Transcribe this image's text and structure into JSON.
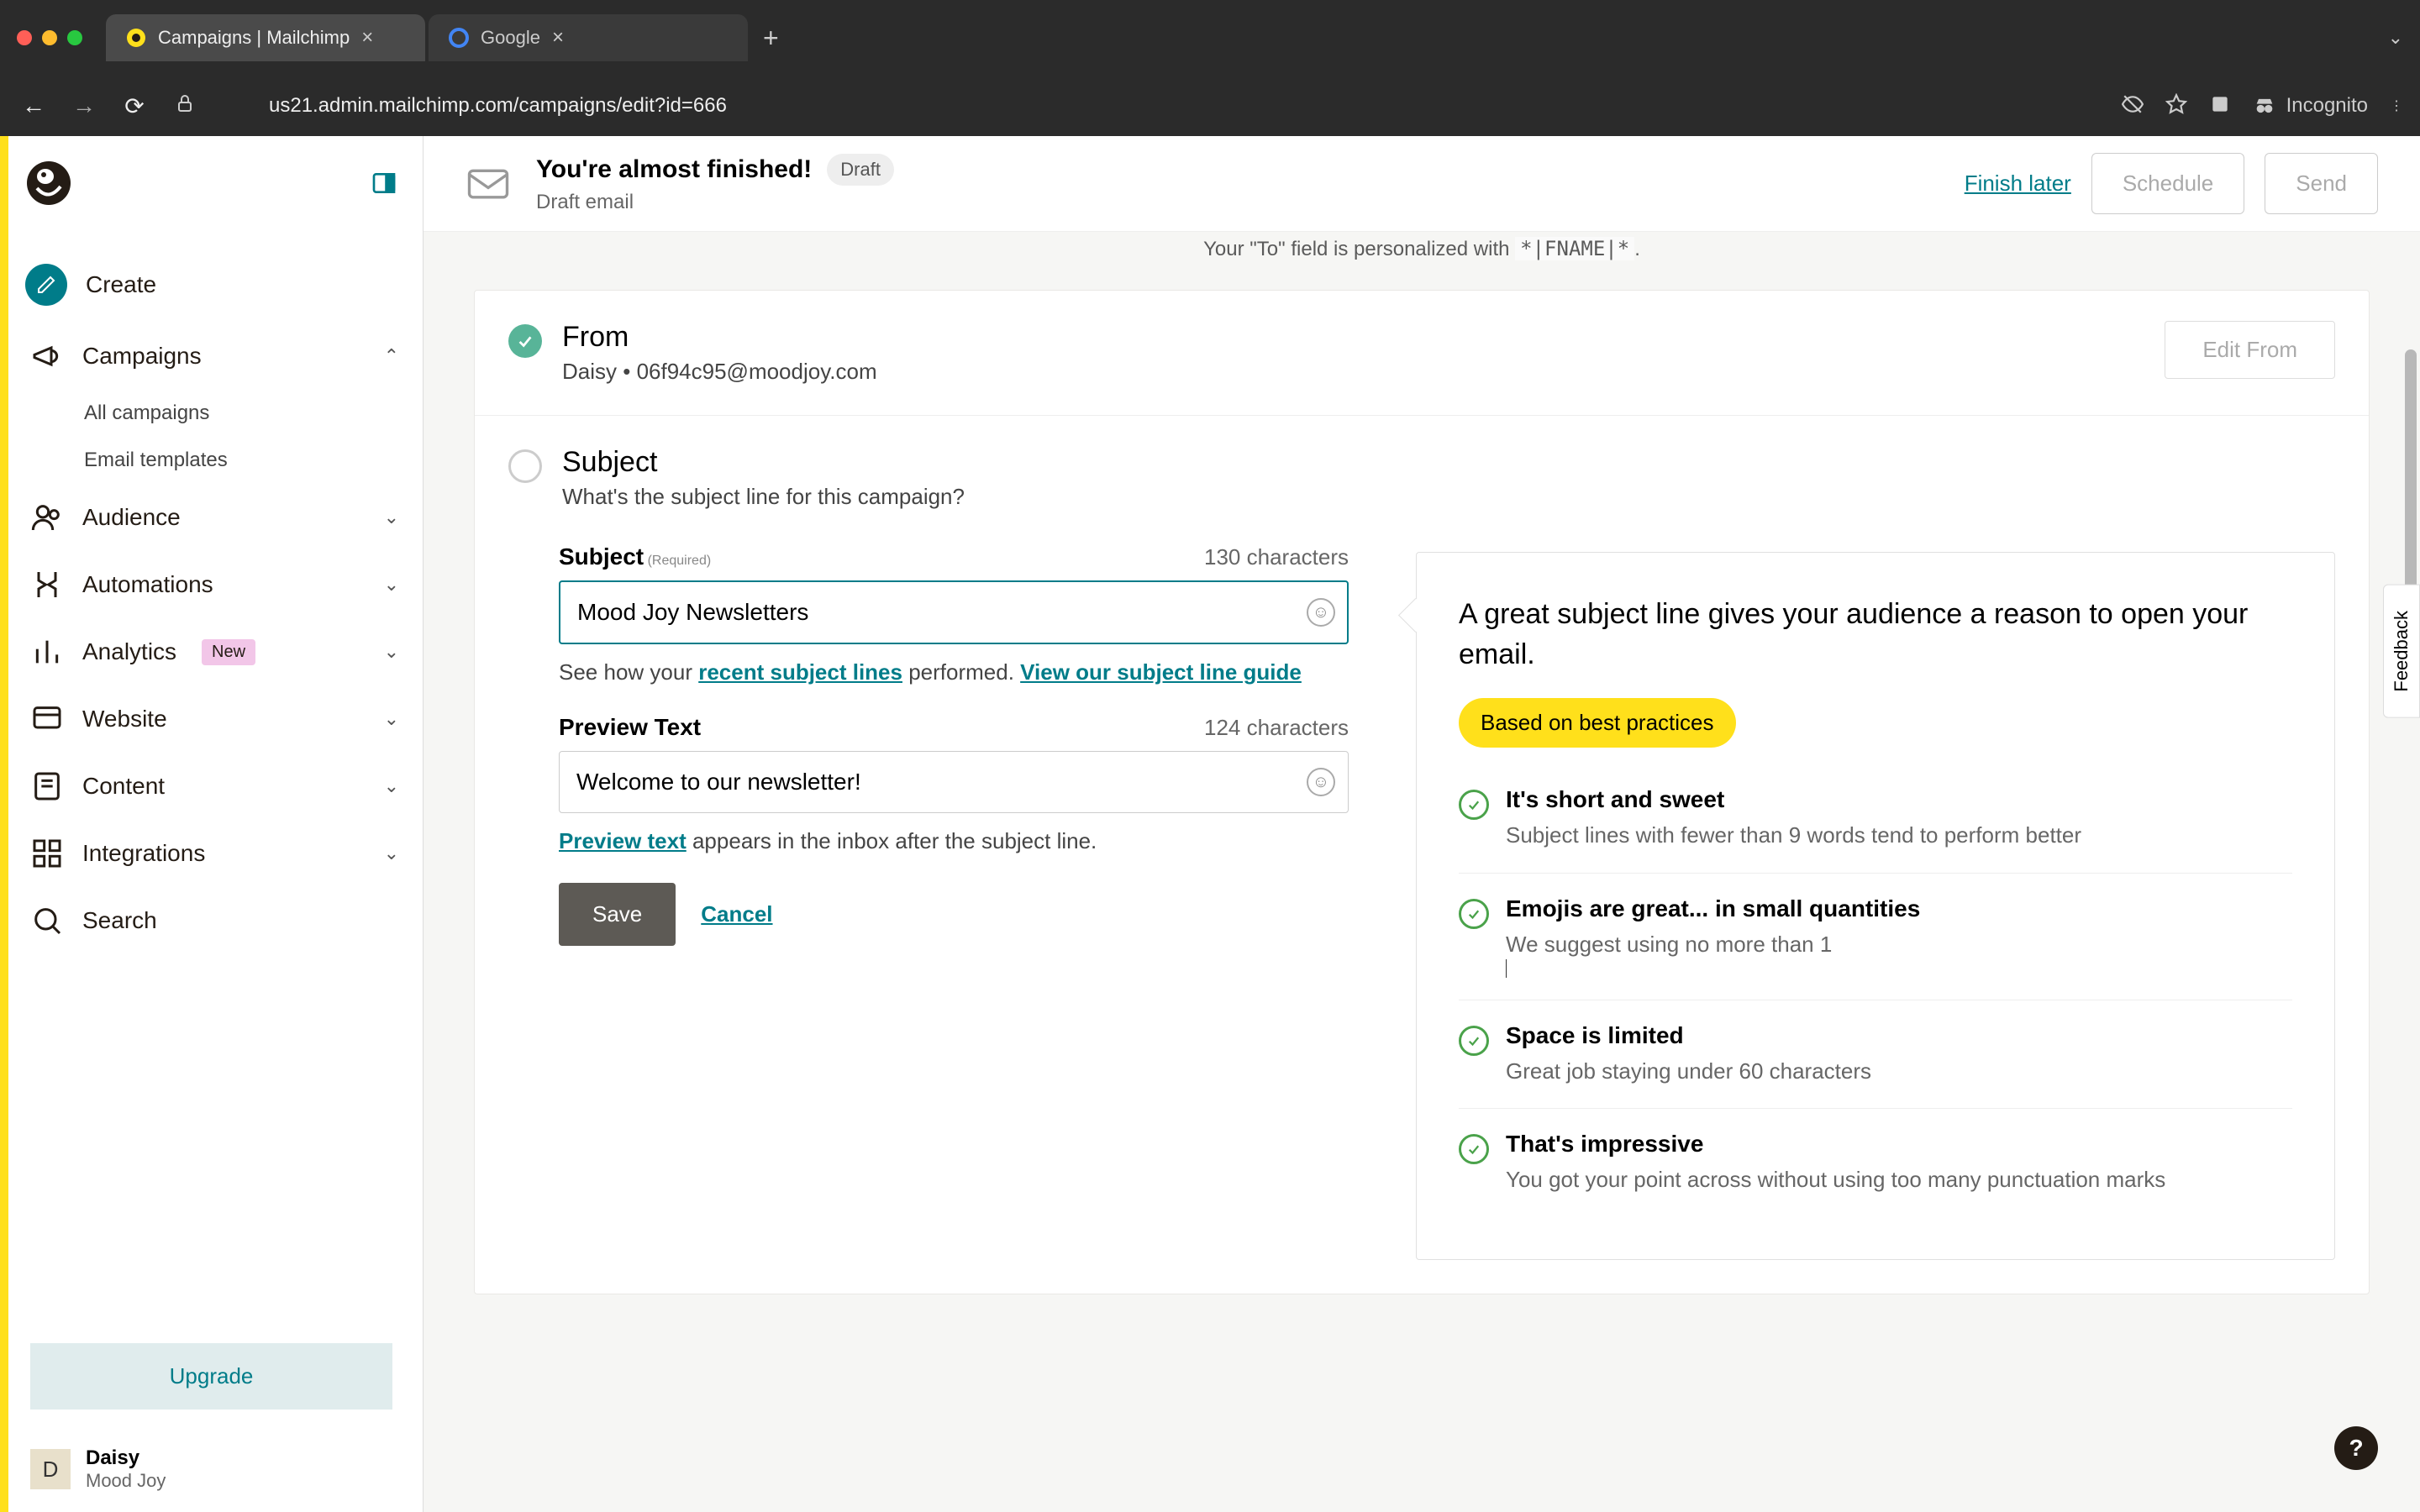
{
  "browser": {
    "tabs": [
      {
        "title": "Campaigns | Mailchimp"
      },
      {
        "title": "Google"
      }
    ],
    "url": "us21.admin.mailchimp.com/campaigns/edit?id=666",
    "incognito_label": "Incognito"
  },
  "sidebar": {
    "create": "Create",
    "campaigns": "Campaigns",
    "campaigns_children": {
      "all": "All campaigns",
      "templates": "Email templates"
    },
    "audience": "Audience",
    "automations": "Automations",
    "analytics": "Analytics",
    "analytics_badge": "New",
    "website": "Website",
    "content": "Content",
    "integrations": "Integrations",
    "search": "Search",
    "upgrade": "Upgrade",
    "user": {
      "name": "Daisy",
      "org": "Mood Joy",
      "initial": "D"
    }
  },
  "topbar": {
    "title": "You're almost finished!",
    "status": "Draft",
    "subtitle": "Draft email",
    "finish_later": "Finish later",
    "schedule": "Schedule",
    "send": "Send"
  },
  "peek": {
    "prefix": "Your \"To\" field is personalized with ",
    "token": "*|FNAME|*",
    "suffix": "."
  },
  "from_section": {
    "title": "From",
    "value": "Daisy • 06f94c95@moodjoy.com",
    "edit": "Edit From"
  },
  "subject_section": {
    "title": "Subject",
    "question": "What's the subject line for this campaign?",
    "subject_label": "Subject",
    "required": "(Required)",
    "subject_chars": "130 characters",
    "subject_value": "Mood Joy Newsletters",
    "helper_pre": "See how your ",
    "helper_link1": "recent subject lines",
    "helper_mid": " performed. ",
    "helper_link2": "View our subject line guide",
    "preview_label": "Preview Text",
    "preview_chars": "124 characters",
    "preview_value": "Welcome to our newsletter!",
    "preview_helper_link": "Preview text",
    "preview_helper_rest": " appears in the inbox after the subject line.",
    "save": "Save",
    "cancel": "Cancel"
  },
  "tips": {
    "heading": "A great subject line gives your audience a reason to open your email.",
    "badge": "Based on best practices",
    "items": [
      {
        "title": "It's short and sweet",
        "desc": "Subject lines with fewer than 9 words tend to perform better"
      },
      {
        "title": "Emojis are great... in small quantities",
        "desc": "We suggest using no more than 1"
      },
      {
        "title": "Space is limited",
        "desc": "Great job staying under 60 characters"
      },
      {
        "title": "That's impressive",
        "desc": "You got your point across without using too many punctuation marks"
      }
    ]
  },
  "feedback": "Feedback",
  "help": "?"
}
